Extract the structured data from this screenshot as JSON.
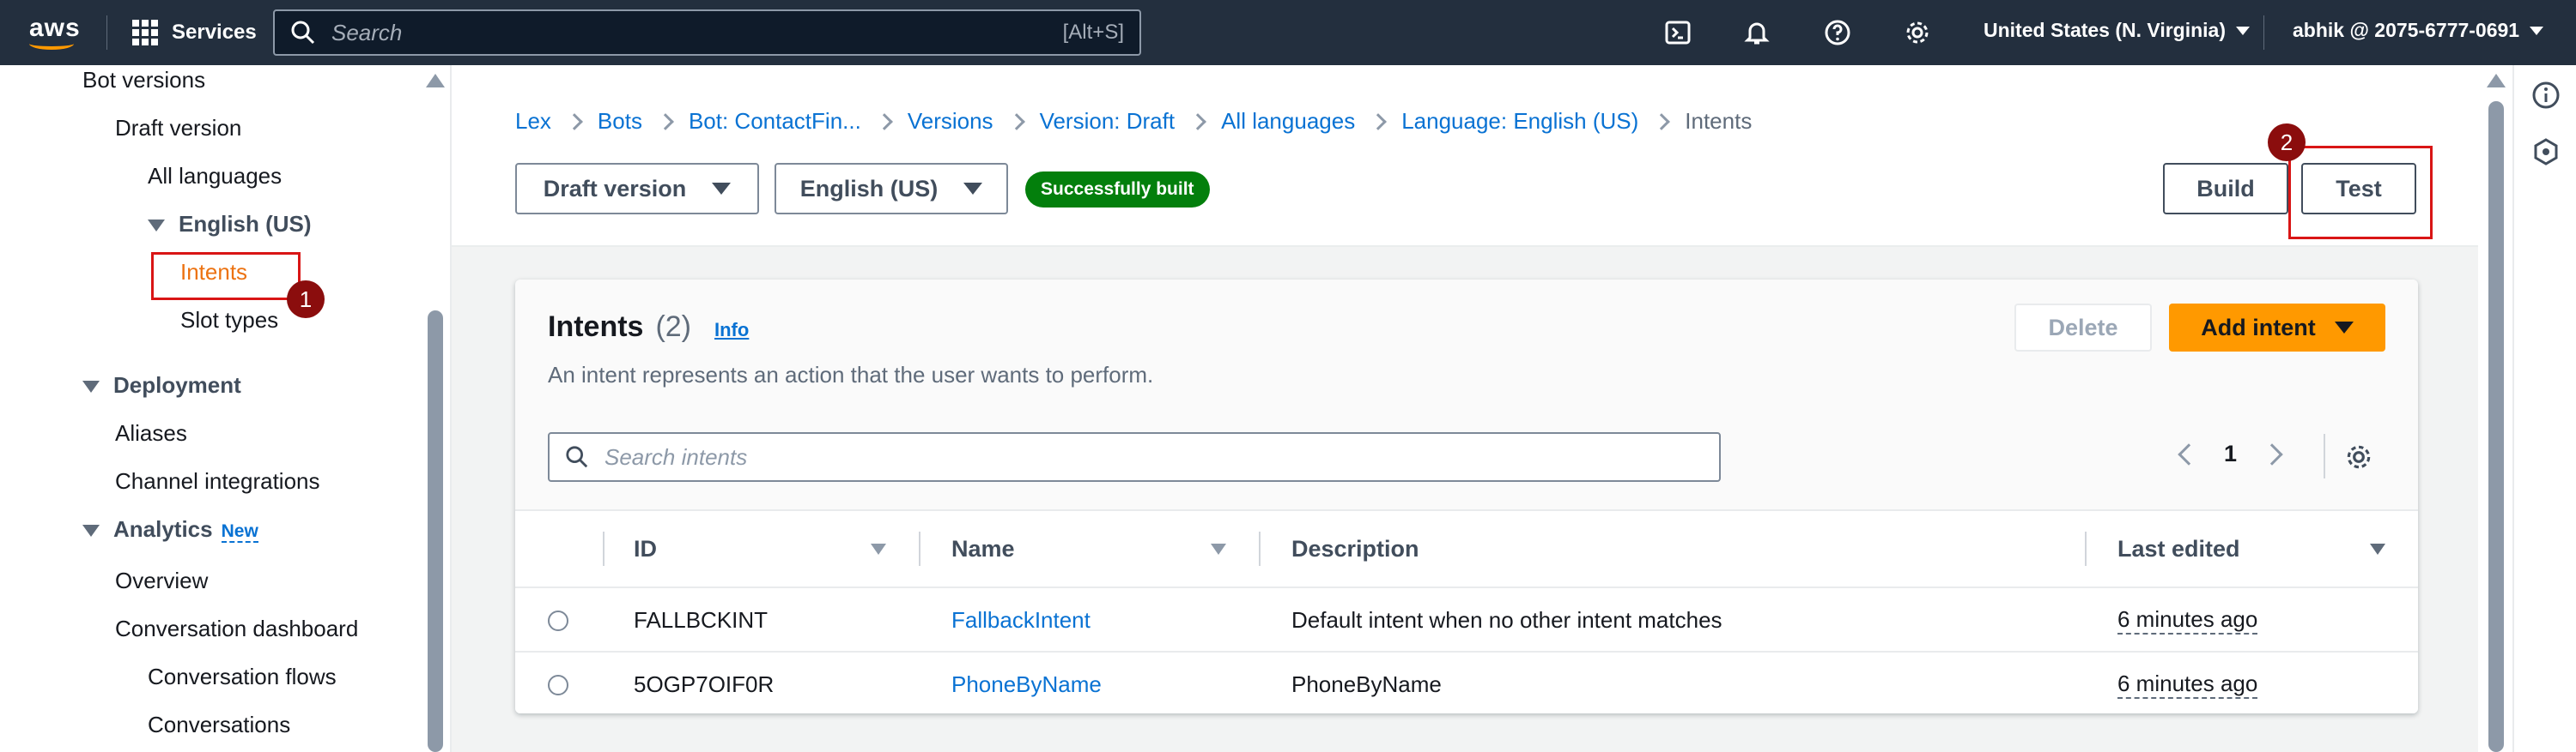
{
  "topnav": {
    "logo": "aws",
    "services_label": "Services",
    "search_placeholder": "Search",
    "search_shortcut": "[Alt+S]",
    "icons": [
      "cloudshell-icon",
      "bell-icon",
      "help-icon",
      "gear-icon"
    ],
    "region": "United States (N. Virginia)",
    "account": "abhik @ 2075-6777-0691"
  },
  "sidebar": {
    "bot_versions": "Bot versions",
    "draft_version": "Draft version",
    "all_languages": "All languages",
    "english_us": "English (US)",
    "intents": "Intents",
    "slot_types": "Slot types",
    "deployment": "Deployment",
    "aliases": "Aliases",
    "channel_integrations": "Channel integrations",
    "analytics": "Analytics",
    "analytics_badge": "New",
    "overview": "Overview",
    "conversation_dashboard": "Conversation dashboard",
    "conversation_flows": "Conversation flows",
    "conversations": "Conversations"
  },
  "annotations": {
    "step1": "1",
    "step2": "2",
    "highlight_color": "#d91515"
  },
  "breadcrumb": [
    "Lex",
    "Bots",
    "Bot: ContactFin...",
    "Versions",
    "Version: Draft",
    "All languages",
    "Language: English (US)"
  ],
  "breadcrumb_current": "Intents",
  "header": {
    "version_select": "Draft version",
    "language_select": "English (US)",
    "status_badge": "Successfully built",
    "build_label": "Build",
    "test_label": "Test"
  },
  "intents_panel": {
    "title": "Intents",
    "count": "(2)",
    "info": "Info",
    "description": "An intent represents an action that the user wants to perform.",
    "delete_label": "Delete",
    "add_label": "Add intent",
    "search_placeholder": "Search intents",
    "page": "1",
    "columns": [
      "ID",
      "Name",
      "Description",
      "Last edited"
    ],
    "rows": [
      {
        "id": "FALLBCKINT",
        "name": "FallbackIntent",
        "description": "Default intent when no other intent matches",
        "last_edited": "6 minutes ago"
      },
      {
        "id": "5OGP7OIF0R",
        "name": "PhoneByName",
        "description": "PhoneByName",
        "last_edited": "6 minutes ago"
      }
    ]
  },
  "colors": {
    "nav_bg": "#232f3e",
    "accent_orange": "#ff9900",
    "link_blue": "#0972d3",
    "success_green": "#037f0c"
  }
}
